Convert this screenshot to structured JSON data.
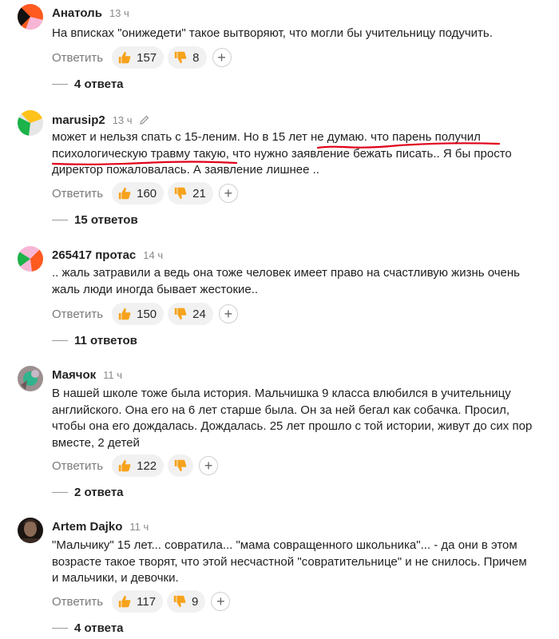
{
  "comments": [
    {
      "author": "Анатоль",
      "time": "13 ч",
      "lines": [
        "На вписках \"онижедети\" такое вытворяют, что могли бы учительницу подучить."
      ],
      "reply_label": "Ответить",
      "likes": "157",
      "dislikes": "8",
      "replies": "4 ответа",
      "avatar_colors": [
        "#ff5a1f",
        "#111111",
        "#f8b6d6"
      ]
    },
    {
      "author": "marusip2",
      "time": "13 ч",
      "edited_icon": "pencil-icon",
      "lines": [
        "может и нельзя спать с 15-леним. Но в 15 лет не думаю. что парень получил",
        "психологическую травму такую, что нужно заявление бежать писать.. Я бы просто",
        "директор пожаловалась. А заявление лишнее .."
      ],
      "reply_label": "Ответить",
      "likes": "160",
      "dislikes": "21",
      "replies": "15 ответов",
      "avatar_colors": [
        "#ffc21a",
        "#1bb34a",
        "#e6e6e6"
      ]
    },
    {
      "author": "265417 протас",
      "time": "14 ч",
      "lines": [
        ".. жаль затравили а ведь она тоже человек имеет право на счастливую жизнь очень",
        "жаль люди иногда бывает жестокие.."
      ],
      "reply_label": "Ответить",
      "likes": "150",
      "dislikes": "24",
      "replies": "11 ответов",
      "avatar_colors": [
        "#ff5a1f",
        "#1bb34a",
        "#f8b6d6"
      ]
    },
    {
      "author": "Маячок",
      "time": "11 ч",
      "lines": [
        "В нашей школе тоже была история. Мальчишка 9 класса влюбился в учительницу",
        "английского. Она его на 6 лет старше была. Он за ней бегал как собачка. Просил,",
        "чтобы она его дождалась. Дождалась. 25 лет прошло с той истории, живут до сих пор",
        "вместе, 2 детей"
      ],
      "reply_label": "Ответить",
      "likes": "122",
      "dislikes": "",
      "replies": "2 ответа",
      "avatar_colors": [
        "#9c8f8f",
        "#2fb48c",
        "#c7b9c5"
      ]
    },
    {
      "author": "Artem Dajko",
      "time": "11 ч",
      "lines": [
        "\"Мальчику\" 15 лет... совратила... \"мама совращенного школьника\"... - да они в этом",
        "возрасте такое творят, что этой несчастной \"совратительнице\" и не снилось. Причем",
        "и мальчики, и девочки."
      ],
      "reply_label": "Ответить",
      "likes": "117",
      "dislikes": "9",
      "replies": "4 ответа",
      "avatar_colors": [
        "#3a2a22",
        "#8a6a55",
        "#1a1412"
      ]
    }
  ],
  "icons": {
    "like": "thumbs-up-icon",
    "dislike": "thumbs-down-icon",
    "add_reaction": "plus-icon"
  },
  "colors": {
    "thumb": "#f7a21b",
    "underline": "#e0001a",
    "pill_bg": "#f1f1f1",
    "meta": "#8a8a8a"
  }
}
